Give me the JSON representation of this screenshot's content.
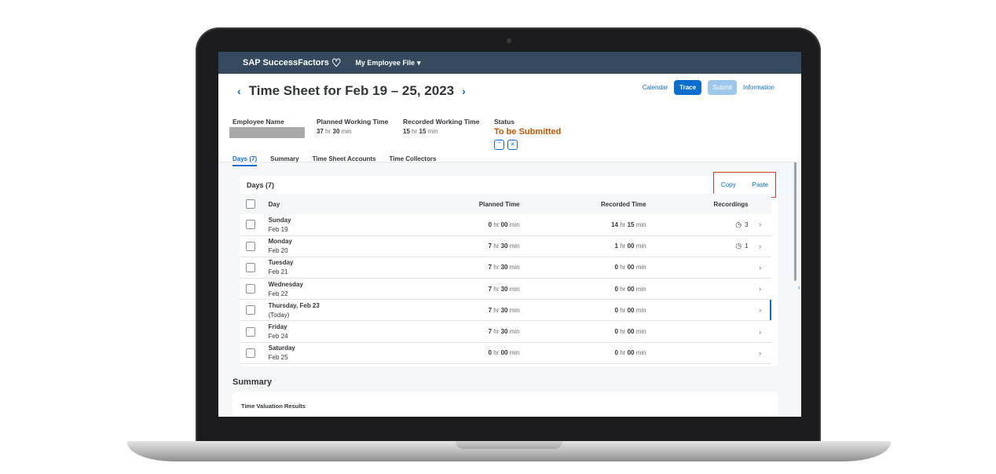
{
  "shell": {
    "brand": "SAP SuccessFactors",
    "module": "My Employee File"
  },
  "header": {
    "title": "Time Sheet for Feb 19 – 25, 2023",
    "actions": {
      "calendar": "Calendar",
      "trace": "Trace",
      "submit": "Submit",
      "information": "Information"
    }
  },
  "attributes": {
    "employee_name_label": "Employee Name",
    "planned_label": "Planned Working Time",
    "planned_hr": "37",
    "planned_min": "30",
    "recorded_label": "Recorded Working Time",
    "recorded_hr": "15",
    "recorded_min": "15",
    "status_label": "Status",
    "status_value": "To be Submitted",
    "units": {
      "hr": "hr",
      "min": "min"
    }
  },
  "tabs": [
    "Days (7)",
    "Summary",
    "Time Sheet Accounts",
    "Time Collectors"
  ],
  "days_card": {
    "title": "Days (7)",
    "copy": "Copy",
    "paste": "Paste",
    "columns": {
      "day": "Day",
      "planned": "Planned Time",
      "recorded": "Recorded Time",
      "recordings": "Recordings"
    },
    "rows": [
      {
        "day": "Sunday",
        "date": "Feb 19",
        "p_hr": "0",
        "p_min": "00",
        "r_hr": "14",
        "r_min": "15",
        "recordings": "3"
      },
      {
        "day": "Monday",
        "date": "Feb 20",
        "p_hr": "7",
        "p_min": "30",
        "r_hr": "1",
        "r_min": "00",
        "recordings": "1"
      },
      {
        "day": "Tuesday",
        "date": "Feb 21",
        "p_hr": "7",
        "p_min": "30",
        "r_hr": "0",
        "r_min": "00",
        "recordings": ""
      },
      {
        "day": "Wednesday",
        "date": "Feb 22",
        "p_hr": "7",
        "p_min": "30",
        "r_hr": "0",
        "r_min": "00",
        "recordings": ""
      },
      {
        "day": "Thursday, Feb 23",
        "date": "(Today)",
        "p_hr": "7",
        "p_min": "30",
        "r_hr": "0",
        "r_min": "00",
        "recordings": ""
      },
      {
        "day": "Friday",
        "date": "Feb 24",
        "p_hr": "7",
        "p_min": "30",
        "r_hr": "0",
        "r_min": "00",
        "recordings": ""
      },
      {
        "day": "Saturday",
        "date": "Feb 25",
        "p_hr": "0",
        "p_min": "00",
        "r_hr": "0",
        "r_min": "00",
        "recordings": ""
      }
    ]
  },
  "summary": {
    "title": "Summary",
    "subtitle": "Time Valuation Results"
  }
}
